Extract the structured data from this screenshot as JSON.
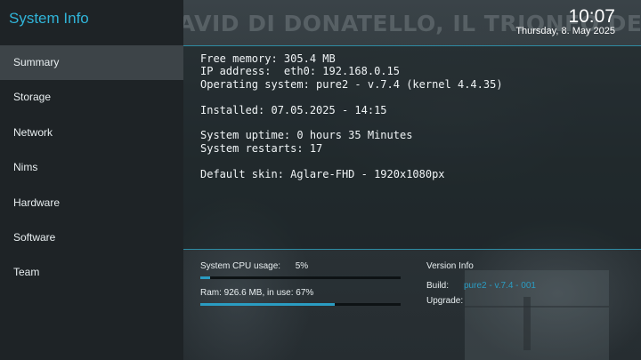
{
  "app_title": "System Info",
  "clock": {
    "time": "10:07",
    "date": "Thursday,  8. May 2025"
  },
  "background_banner": "AVID DI DONATELLO, IL TRIONFO DELLE DO",
  "menu": {
    "items": [
      {
        "label": "Summary",
        "selected": true
      },
      {
        "label": "Storage",
        "selected": false
      },
      {
        "label": "Network",
        "selected": false
      },
      {
        "label": "Nims",
        "selected": false
      },
      {
        "label": "Hardware",
        "selected": false
      },
      {
        "label": "Software",
        "selected": false
      },
      {
        "label": "Team",
        "selected": false
      }
    ]
  },
  "summary": {
    "lines": [
      "Free memory: 305.4 MB",
      "IP address:  eth0: 192.168.0.15",
      "Operating system: pure2 - v.7.4 (kernel 4.4.35)",
      "",
      "Installed: 07.05.2025 - 14:15",
      "",
      "System uptime: 0 hours 35 Minutes",
      "System restarts: 17",
      "",
      "Default skin: Aglare-FHD - 1920x1080px"
    ]
  },
  "usage": {
    "cpu_label": "System CPU usage:      5%",
    "cpu_percent": 5,
    "ram_label": "Ram: 926.6 MB, in use: 67%",
    "ram_percent": 67
  },
  "version": {
    "title": "Version Info",
    "build_label": "Build:",
    "build_value": "pure2 - v.7.4 - 001",
    "upgrade_label": "Upgrade:"
  },
  "colors": {
    "accent": "#30b4d8",
    "bar_fill": "#2a9cc2",
    "sidebar": "#1e2326",
    "selected": "#3d4448"
  }
}
